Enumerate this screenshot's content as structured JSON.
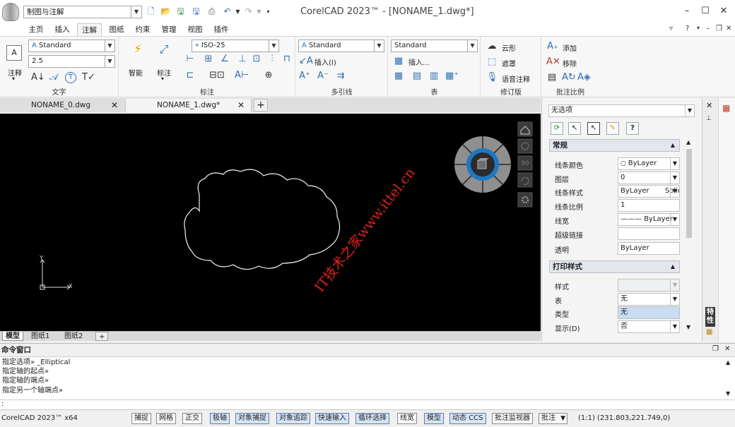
{
  "titlebar": {
    "workspace": "制图与注解",
    "title": "CorelCAD 2023™ - [NONAME_1.dwg*]"
  },
  "ribbon_tabs": [
    {
      "label": "主页"
    },
    {
      "label": "插入"
    },
    {
      "label": "注解"
    },
    {
      "label": "图纸"
    },
    {
      "label": "约束"
    },
    {
      "label": "管理"
    },
    {
      "label": "视图"
    },
    {
      "label": "插件"
    }
  ],
  "ribbon": {
    "text_group": {
      "label": "文字",
      "big_button": "注释",
      "style": "Standard",
      "height": "2.5"
    },
    "dim_group": {
      "label": "标注",
      "smart": "智能",
      "mark": "标注",
      "style": "ISO-25"
    },
    "mleader_group": {
      "label": "多引线",
      "style": "Standard",
      "insert": "插入(I)"
    },
    "table_group": {
      "label": "表",
      "style": "Standard",
      "insert": "插入..."
    },
    "markup_group": {
      "label": "修订版",
      "cloud": "云形",
      "mask": "遮罩",
      "voice": "语音注释"
    },
    "scale_group": {
      "label": "批注比例",
      "add": "添加",
      "remove": "移除"
    }
  },
  "doc_tabs": [
    {
      "label": "NONAME_0.dwg"
    },
    {
      "label": "NONAME_1.dwg*"
    }
  ],
  "canvas": {
    "axis_x": "X",
    "axis_y": "Y",
    "nav_90": "90",
    "watermark": "IT技术之家www.ittel.cn"
  },
  "model_tabs": [
    {
      "label": "模型"
    },
    {
      "label": "图纸1"
    },
    {
      "label": "图纸2"
    }
  ],
  "properties": {
    "selection": "无选项",
    "general_section": "常规",
    "general": [
      {
        "name": "线条颜色",
        "value": "ByLayer"
      },
      {
        "name": "图层",
        "value": "0"
      },
      {
        "name": "线条样式",
        "value": "ByLayer       Solid"
      },
      {
        "name": "线条比例",
        "value": "1"
      },
      {
        "name": "线宽",
        "value": "——— ByLayer"
      },
      {
        "name": "超级链接",
        "value": ""
      },
      {
        "name": "透明",
        "value": "ByLayer"
      }
    ],
    "print_section": "打印样式",
    "print": [
      {
        "name": "样式",
        "value": ""
      },
      {
        "name": "表",
        "value": "无"
      },
      {
        "name": "类型",
        "value": "无"
      },
      {
        "name": "显示(D)",
        "value": "否"
      }
    ],
    "side_label": "特性"
  },
  "command": {
    "header": "命令窗口",
    "lines": [
      "指定选项» _Elliptical",
      "指定轴的起点»",
      "指定轴的端点»",
      "指定另一个轴端点»"
    ],
    "prompt": ":"
  },
  "status": {
    "app": "CorelCAD 2023™ x64",
    "buttons": [
      {
        "label": "捕捉",
        "on": false
      },
      {
        "label": "网格",
        "on": false
      },
      {
        "label": "正交",
        "on": false
      },
      {
        "label": "极轴",
        "on": true
      },
      {
        "label": "对象捕捉",
        "on": true
      },
      {
        "label": "对象追踪",
        "on": true
      },
      {
        "label": "快速输入",
        "on": true
      },
      {
        "label": "循环选择",
        "on": true
      },
      {
        "label": "线宽",
        "on": false
      },
      {
        "label": "模型",
        "on": true
      },
      {
        "label": "动态 CCS",
        "on": true
      },
      {
        "label": "批注监视器",
        "on": false
      }
    ],
    "annot": "批注",
    "scale": "(1:1)",
    "coords": "(231.803,221.749,0)"
  },
  "colors": {
    "canvas": "#000000",
    "accent": "#2f6fb3",
    "watermark": "#e0201e"
  }
}
